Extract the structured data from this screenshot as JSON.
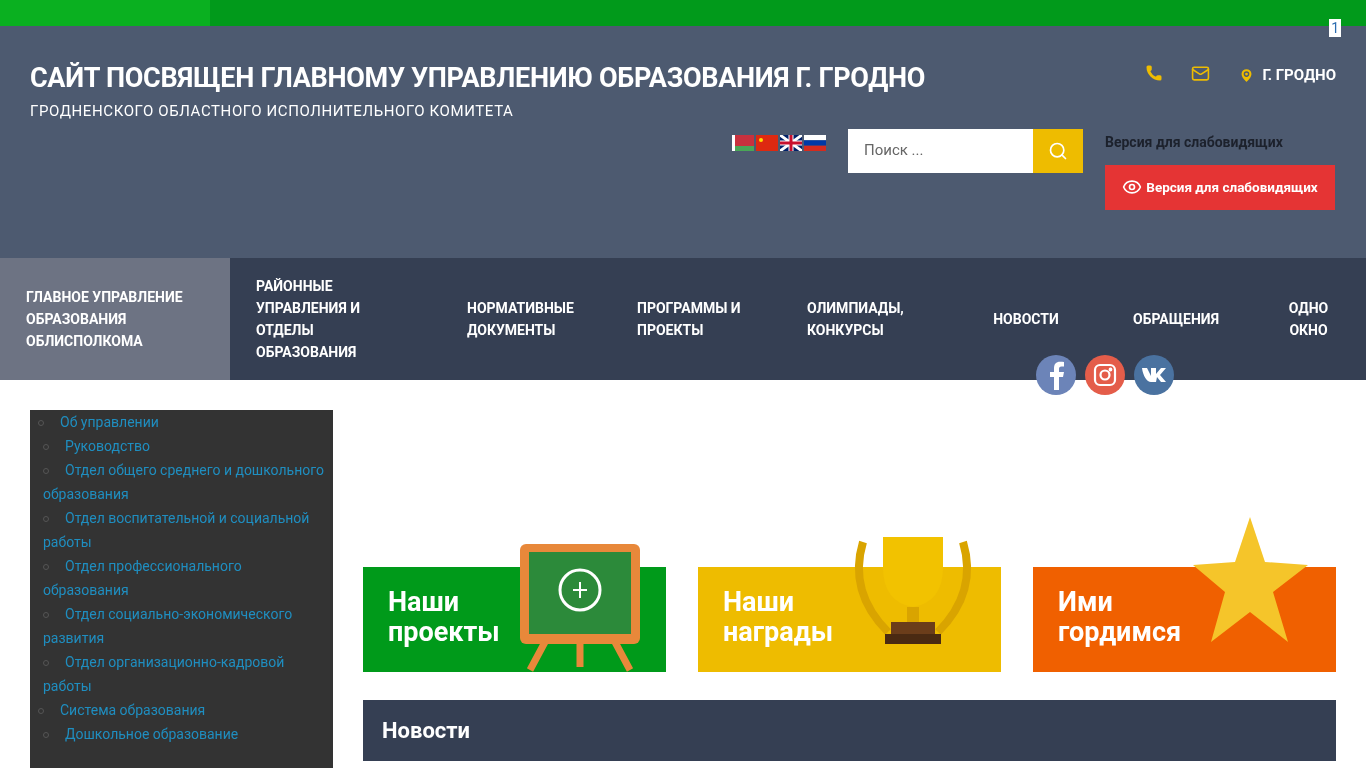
{
  "corner_badge": "1",
  "header": {
    "title": "САЙТ ПОСВЯЩЕН ГЛАВНОМУ УПРАВЛЕНИЮ ОБРАЗОВАНИЯ Г. ГРОДНО",
    "subtitle": "ГРОДНЕНСКОГО ОБЛАСТНОГО ИСПОЛНИТЕЛЬНОГО КОМИТЕТА",
    "location": "Г. ГРОДНО"
  },
  "search": {
    "placeholder": "Поиск ..."
  },
  "accessibility": {
    "caption": "Версия для слабовидящих",
    "button": "Версия для слабовидящих"
  },
  "nav": [
    {
      "label": "ГЛАВНОЕ УПРАВЛЕНИЕ ОБРАЗОВАНИЯ ОБЛИСПОЛКОМА",
      "selected": true
    },
    {
      "label": "РАЙОННЫЕ УПРАВЛЕНИЯ И ОТДЕЛЫ ОБРАЗОВАНИЯ",
      "selected": false
    },
    {
      "label": "НОРМАТИВНЫЕ ДОКУМЕНТЫ",
      "selected": false
    },
    {
      "label": "ПРОГРАММЫ И ПРОЕКТЫ",
      "selected": false
    },
    {
      "label": "ОЛИМПИАДЫ, КОНКУРСЫ",
      "selected": false
    },
    {
      "label": "НОВОСТИ",
      "selected": false
    },
    {
      "label": "ОБРАЩЕНИЯ",
      "selected": false
    },
    {
      "label": "ОДНО ОКНО",
      "selected": false
    }
  ],
  "sidebar": {
    "items": [
      {
        "label": "Об управлении",
        "children": [
          {
            "label": "Руководство"
          },
          {
            "label": "Отдел общего среднего и дошкольного образования"
          },
          {
            "label": "Отдел воспитательной и социальной работы"
          },
          {
            "label": "Отдел профессионального образования"
          },
          {
            "label": "Отдел социально-экономического развития"
          },
          {
            "label": "Отдел организационно-кадровой работы"
          }
        ]
      },
      {
        "label": "Система образования",
        "children": [
          {
            "label": "Дошкольное образование"
          }
        ]
      }
    ]
  },
  "banners": [
    {
      "kind": "projects",
      "title": "Наши проекты",
      "color": "#009a1a"
    },
    {
      "kind": "awards",
      "title": "Наши награды",
      "color": "#eebc00"
    },
    {
      "kind": "pride",
      "title": "Ими гордимся",
      "color": "#f06000"
    }
  ],
  "news": {
    "title": "Новости"
  }
}
